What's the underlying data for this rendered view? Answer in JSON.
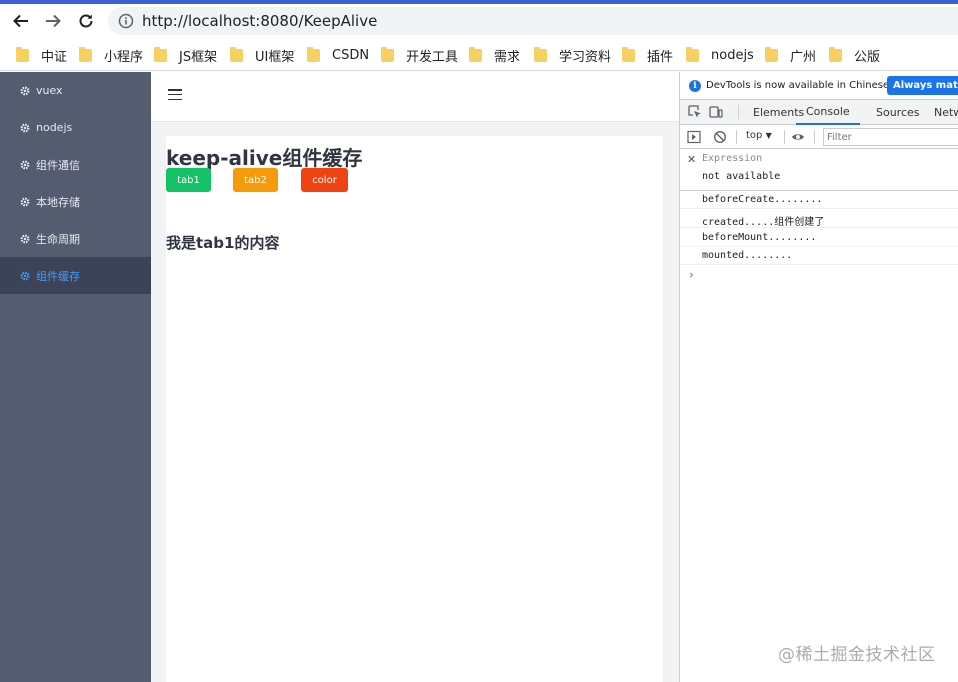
{
  "browser": {
    "url": "http://localhost:8080/KeepAlive",
    "bookmarks": [
      "中证",
      "小程序",
      "JS框架",
      "UI框架",
      "CSDN",
      "开发工具",
      "需求",
      "学习资料",
      "插件",
      "nodejs",
      "广州",
      "公版"
    ]
  },
  "sidebar": {
    "items": [
      {
        "label": "vuex"
      },
      {
        "label": "nodejs"
      },
      {
        "label": "组件通信"
      },
      {
        "label": "本地存储"
      },
      {
        "label": "生命周期"
      },
      {
        "label": "组件缓存"
      }
    ],
    "active_index": 5
  },
  "main": {
    "title": "keep-alive组件缓存",
    "tabs": [
      {
        "label": "tab1",
        "color": "#13c265"
      },
      {
        "label": "tab2",
        "color": "#f49a0b"
      },
      {
        "label": "color",
        "color": "#ef4312"
      }
    ],
    "content": "我是tab1的内容"
  },
  "devtools": {
    "info_text": "DevTools is now available in Chinese!",
    "always_match_label": "Always match",
    "tabs": [
      "Elements",
      "Console",
      "Sources",
      "Netw"
    ],
    "active_tab": "Console",
    "context": "top",
    "filter_placeholder": "Filter",
    "expression_label": "Expression",
    "expression_value": "not available",
    "logs": [
      "beforeCreate........",
      "created.....组件创建了",
      "beforeMount........",
      "mounted........"
    ],
    "prompt": "›"
  },
  "watermark": "@稀土掘金技术社区",
  "colors": {
    "sidebar_bg": "#545c70",
    "active_item_bg": "#3c4356",
    "accent": "#409eff",
    "devtools_blue": "#1a73e8"
  }
}
